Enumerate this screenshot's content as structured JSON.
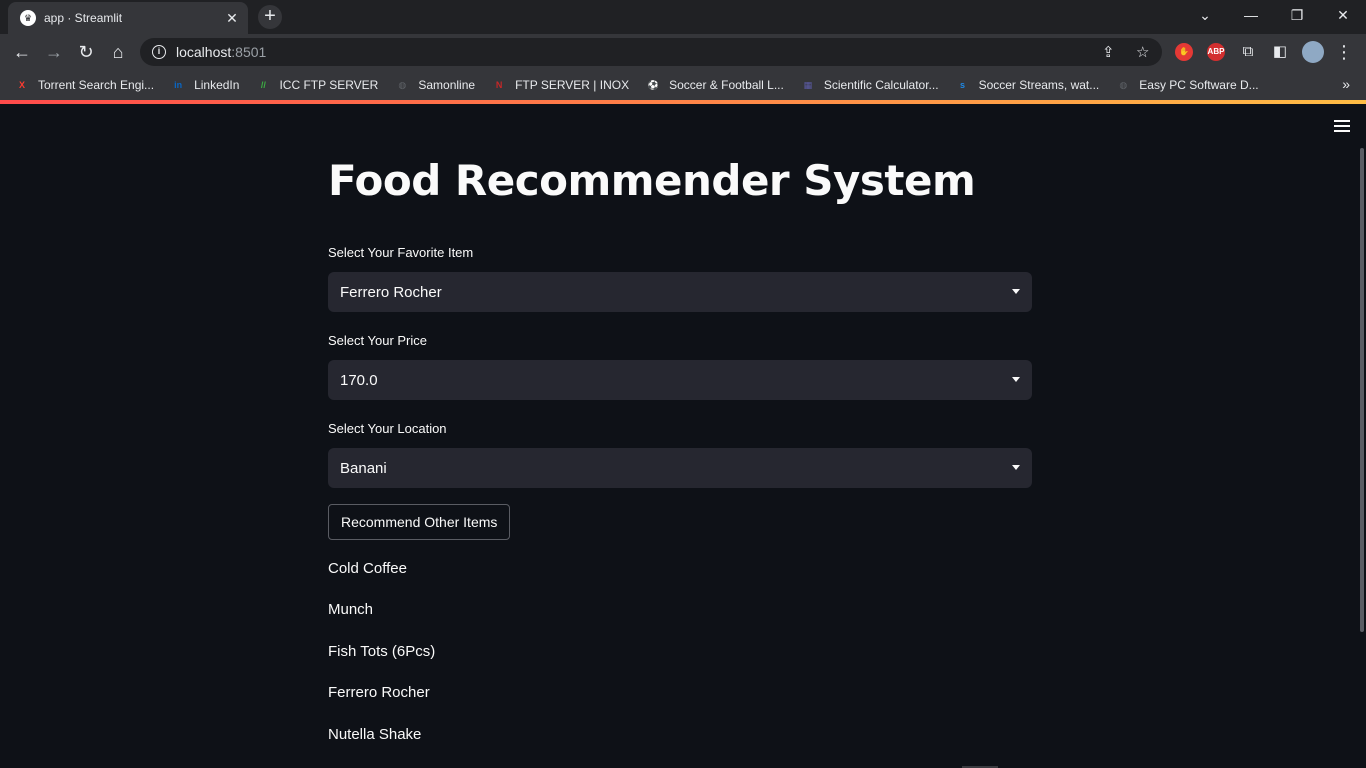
{
  "browser": {
    "tab_title": "app · Streamlit",
    "tab_close": "✕",
    "new_tab": "+",
    "address_host": "localhost",
    "address_port": ":8501",
    "window_controls": [
      "⌄",
      "—",
      "❐",
      "✕"
    ],
    "bookmarks": [
      {
        "label": "Torrent Search Engi...",
        "icon": "x-logo-icon",
        "color": "#ff3b30",
        "glyph": "X"
      },
      {
        "label": "LinkedIn",
        "icon": "linkedin-icon",
        "color": "#0a66c2",
        "glyph": "in"
      },
      {
        "label": "ICC FTP SERVER",
        "icon": "icc-icon",
        "color": "#3cb043",
        "glyph": "//"
      },
      {
        "label": "Samonline",
        "icon": "globe-icon",
        "color": "#5f6368",
        "glyph": "◍"
      },
      {
        "label": "FTP SERVER | INOX",
        "icon": "inox-icon",
        "color": "#c62828",
        "glyph": "N"
      },
      {
        "label": "Soccer & Football L...",
        "icon": "soccer-icon",
        "color": "#6d6d2e",
        "glyph": "⚽"
      },
      {
        "label": "Scientific Calculator...",
        "icon": "calculator-icon",
        "color": "#5c5ca8",
        "glyph": "▦"
      },
      {
        "label": "Soccer Streams, wat...",
        "icon": "streams-icon",
        "color": "#1e88e5",
        "glyph": "s"
      },
      {
        "label": "Easy PC Software D...",
        "icon": "globe-icon",
        "color": "#5f6368",
        "glyph": "◍"
      }
    ],
    "bookmarks_more": "»",
    "extensions": [
      {
        "name": "adblock-icon",
        "color": "#e53935",
        "glyph": "✋"
      },
      {
        "name": "abp-icon",
        "color": "#d32f2f",
        "glyph": "ABP"
      }
    ]
  },
  "app": {
    "title": "Food Recommender System",
    "fields": [
      {
        "label": "Select Your Favorite Item",
        "value": "Ferrero Rocher"
      },
      {
        "label": "Select Your Price",
        "value": "170.0"
      },
      {
        "label": "Select Your Location",
        "value": "Banani"
      }
    ],
    "button_label": "Recommend Other Items",
    "recommendations": [
      "Cold Coffee",
      "Munch",
      "Fish Tots (6Pcs)",
      "Ferrero Rocher",
      "Nutella Shake"
    ]
  }
}
